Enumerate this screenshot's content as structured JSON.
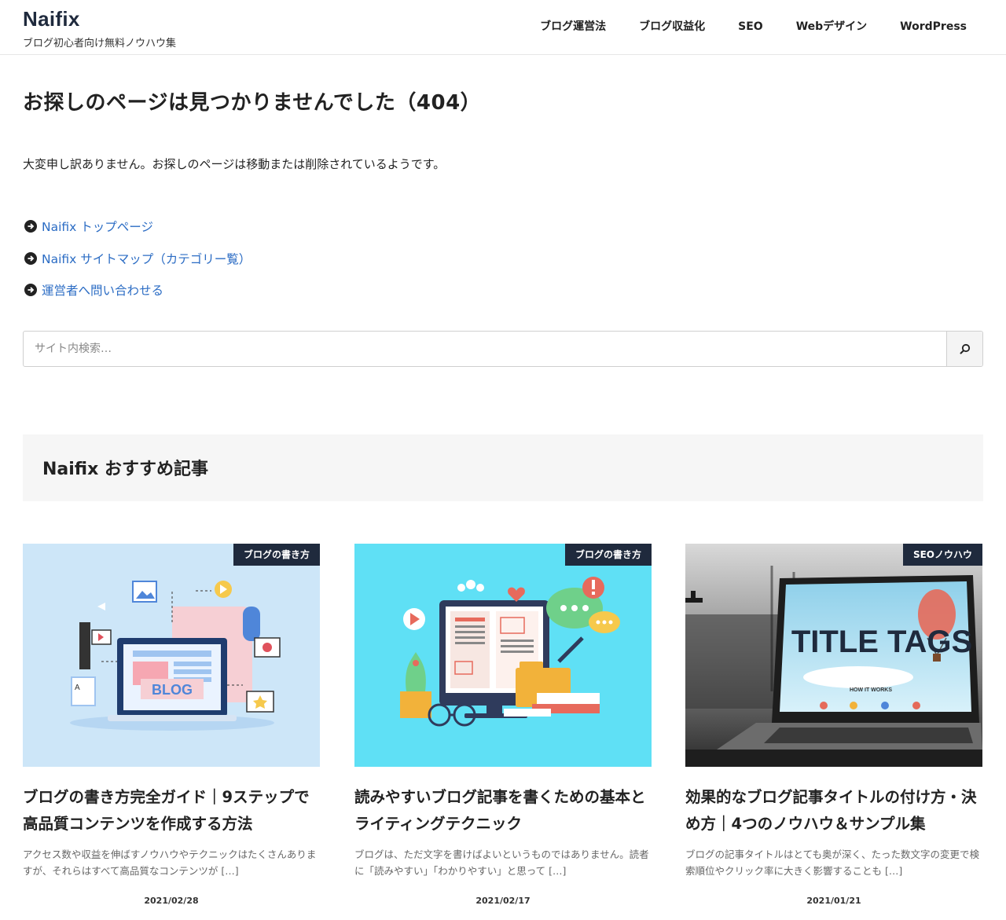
{
  "site": {
    "name": "Naifix",
    "tagline": "ブログ初心者向け無料ノウハウ集"
  },
  "nav": [
    {
      "label": "ブログ運営法"
    },
    {
      "label": "ブログ収益化"
    },
    {
      "label": "SEO"
    },
    {
      "label": "Webデザイン"
    },
    {
      "label": "WordPress"
    }
  ],
  "main": {
    "title": "お探しのページは見つかりませんでした（404）",
    "lead": "大変申し訳ありません。お探しのページは移動または削除されているようです。",
    "links": [
      {
        "label": "Naifix トップページ"
      },
      {
        "label": "Naifix サイトマップ（カテゴリー覧）"
      },
      {
        "label": "運営者へ問い合わせる"
      }
    ]
  },
  "search": {
    "placeholder": "サイト内検索…",
    "icon": "search-icon"
  },
  "recommend": {
    "heading": "Naifix おすすめ記事",
    "cards": [
      {
        "category": "ブログの書き方",
        "thumb_text": "BLOG",
        "title": "ブログの書き方完全ガイド｜9ステップで高品質コンテンツを作成する方法",
        "excerpt": "アクセス数や収益を伸ばすノウハウやテクニックはたくさんありますが、それらはすべて高品質なコンテンツが […]",
        "date": "2021/02/28",
        "bg": "#cde6f8"
      },
      {
        "category": "ブログの書き方",
        "title": "読みやすいブログ記事を書くための基本とライティングテクニック",
        "excerpt": "ブログは、ただ文字を書けばよいというものではありません。読者に「読みやすい」「わかりやすい」と思って […]",
        "date": "2021/02/17",
        "bg": "#5fe0f5"
      },
      {
        "category": "SEOノウハウ",
        "thumb_text": "TITLE TAGS",
        "thumb_subtext": "HOW IT WORKS",
        "title": "効果的なブログ記事タイトルの付け方・決め方｜4つのノウハウ＆サンプル集",
        "excerpt": "ブログの記事タイトルはとても奥が深く、たった数文字の変更で検索順位やクリック率に大きく影響することも […]",
        "date": "2021/01/21",
        "bg": "#5a5a5a"
      }
    ]
  },
  "colors": {
    "brand": "#1f2a3d",
    "link": "#2b6cc4"
  }
}
